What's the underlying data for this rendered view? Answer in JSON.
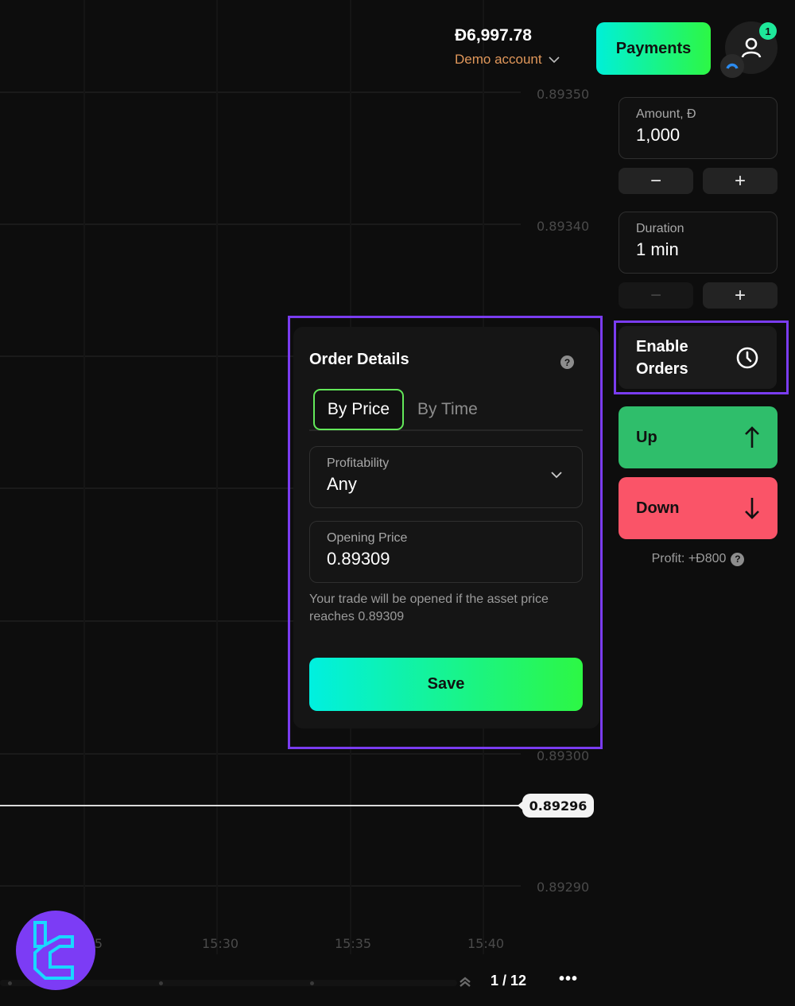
{
  "header": {
    "balance": "Đ6,997.78",
    "account_label": "Demo account",
    "payments_label": "Payments",
    "notification_count": "1"
  },
  "trade_panel": {
    "amount": {
      "label": "Amount, Đ",
      "value": "1,000"
    },
    "duration": {
      "label": "Duration",
      "value": "1 min"
    },
    "minus_symbol": "−",
    "plus_symbol": "+",
    "enable_orders_line1": "Enable",
    "enable_orders_line2": "Orders",
    "up_label": "Up",
    "down_label": "Down",
    "profit_label": "Profit: +Đ800",
    "help_symbol": "?"
  },
  "order_details": {
    "title": "Order Details",
    "tabs": [
      {
        "label": "By Price",
        "active": true
      },
      {
        "label": "By Time",
        "active": false
      }
    ],
    "profitability": {
      "label": "Profitability",
      "value": "Any"
    },
    "opening_price": {
      "label": "Opening Price",
      "value": "0.89309"
    },
    "note": "Your trade will be opened if the asset price reaches 0.89309",
    "save_label": "Save"
  },
  "chart": {
    "y_ticks": [
      "0.89350",
      "0.89340",
      "0.89300",
      "0.89290"
    ],
    "x_ticks": [
      "15:25",
      "15:30",
      "15:35",
      "15:40"
    ],
    "current_price": "0.89296",
    "pager": "1 / 12",
    "more_label": "•••"
  },
  "colors": {
    "accent_purple": "#7a3cf0",
    "up_green": "#2fbe6b",
    "down_red": "#fa5468",
    "account_orange": "#e0975a",
    "gradient_start": "#00f0d8",
    "gradient_end": "#2df744"
  }
}
